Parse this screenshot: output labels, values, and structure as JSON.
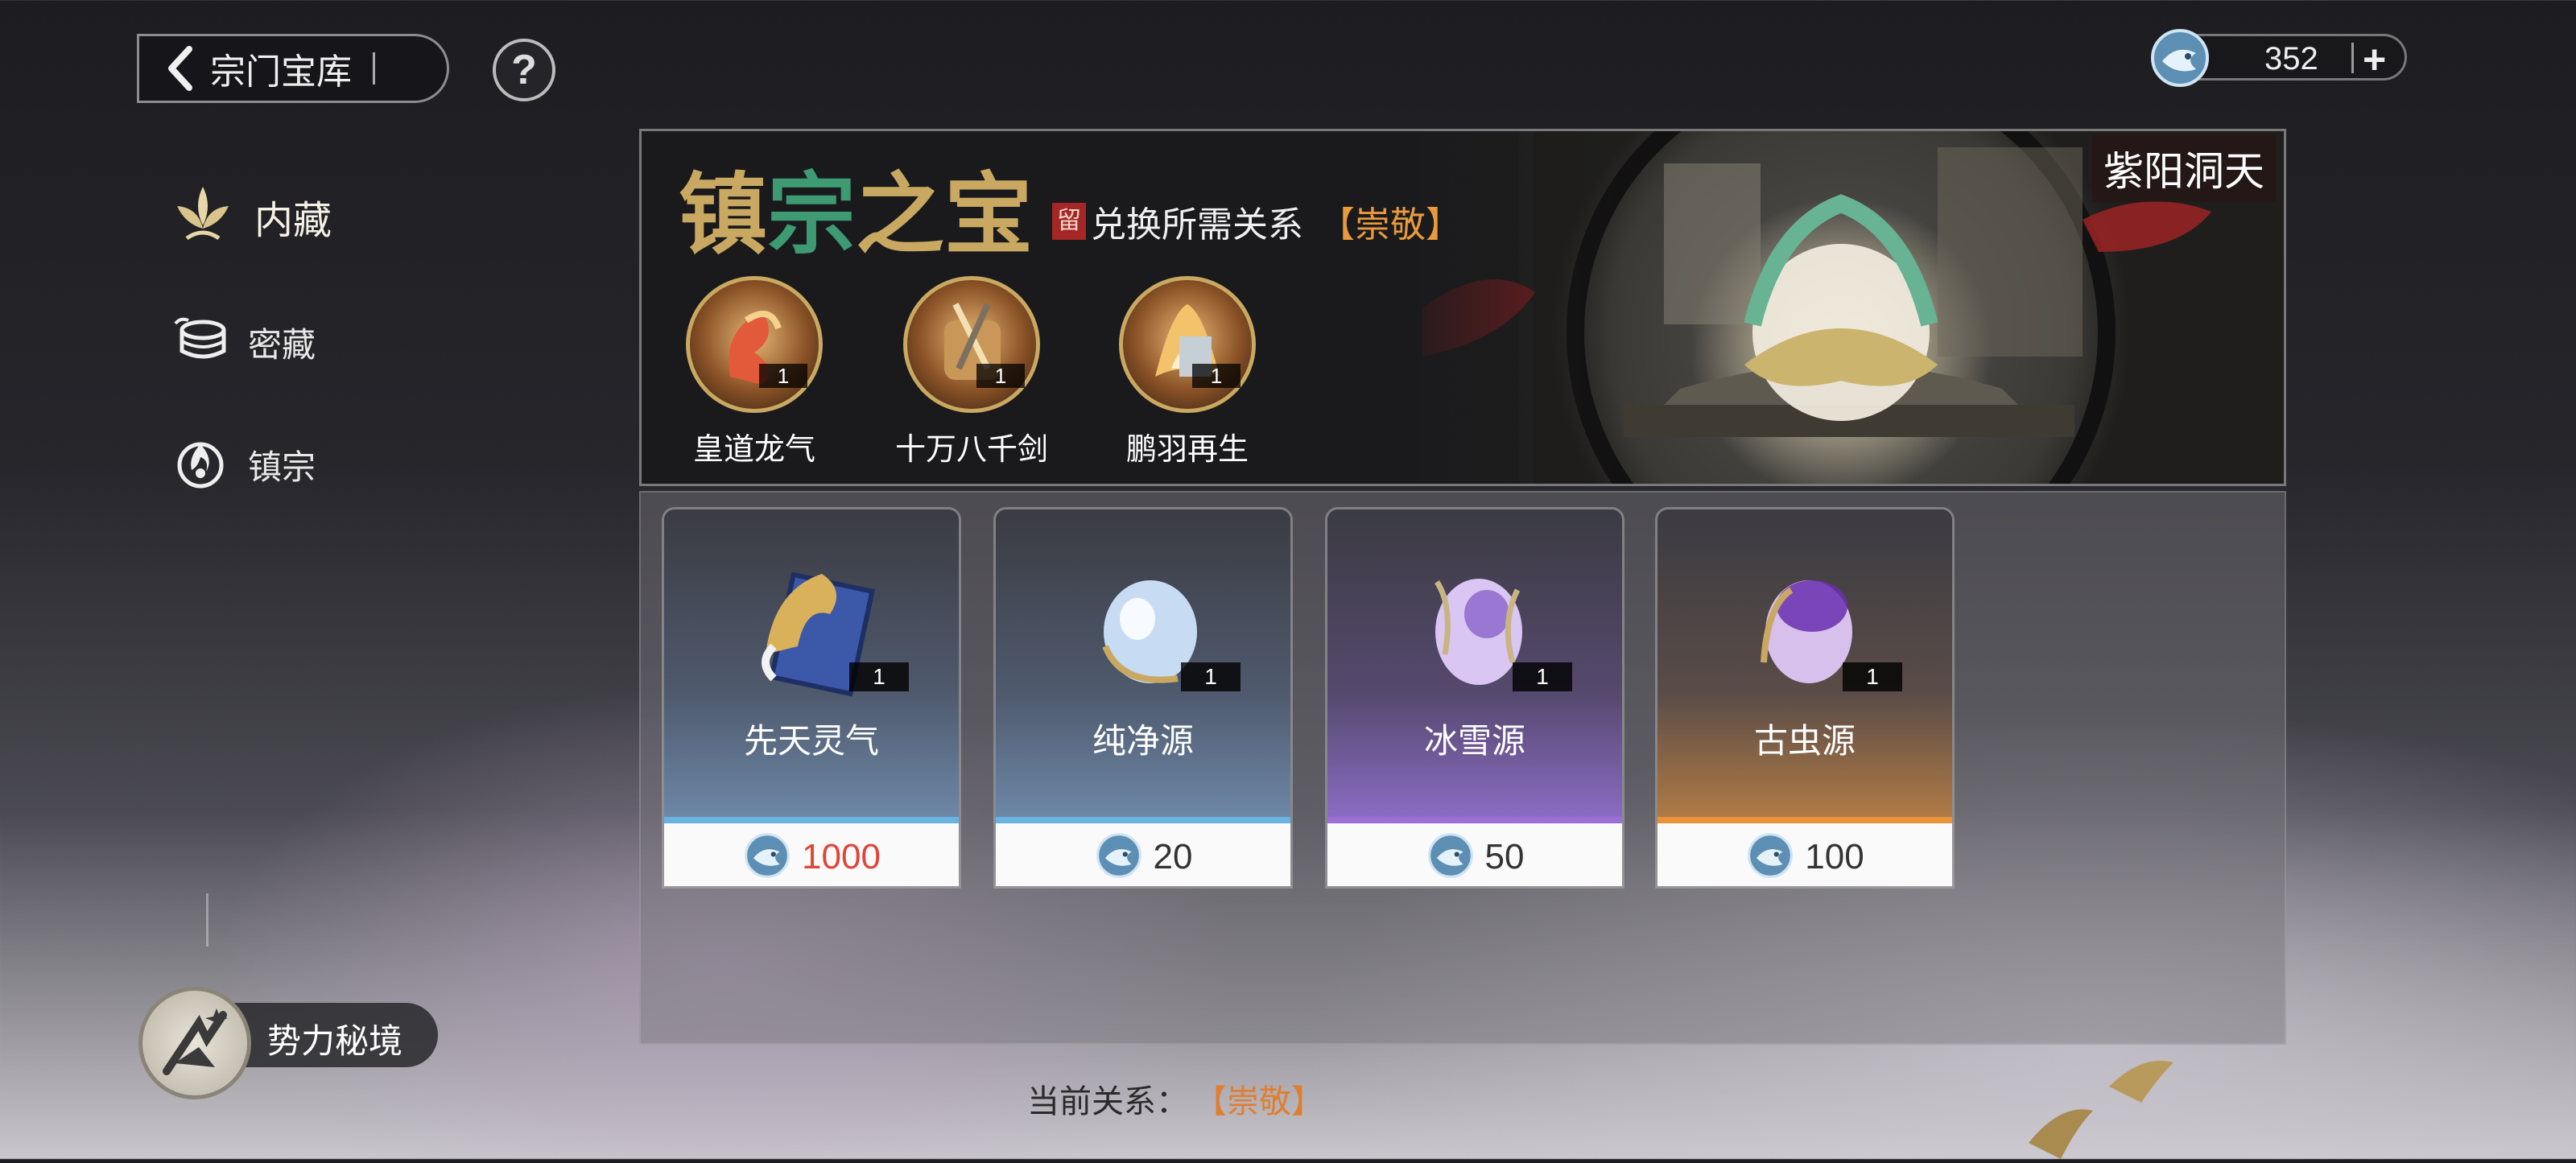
{
  "header": {
    "back_title": "宗门宝库",
    "help_label": "?"
  },
  "currency": {
    "amount": "352",
    "add_label": "+"
  },
  "sidebar": {
    "items": [
      {
        "label": "内藏",
        "active": true
      },
      {
        "label": "密藏",
        "active": false
      },
      {
        "label": "镇宗",
        "active": false
      }
    ]
  },
  "banner": {
    "title_part1": "镇",
    "title_part2": "宗",
    "title_part3": "之宝",
    "stamp": "留",
    "requirement_text": "兑换所需关系",
    "requirement_tag": "【崇敬】",
    "region_name": "紫阳洞天",
    "rewards": [
      {
        "name": "皇道龙气",
        "count": "1"
      },
      {
        "name": "十万八千剑",
        "count": "1"
      },
      {
        "name": "鹏羽再生",
        "count": "1"
      }
    ]
  },
  "shop": {
    "items": [
      {
        "name": "先天灵气",
        "count": "1",
        "price": "1000",
        "price_color": "#e0453a",
        "stripe_color": "#6ab3e0"
      },
      {
        "name": "纯净源",
        "count": "1",
        "price": "20",
        "price_color": "#333333",
        "stripe_color": "#6ab3e0"
      },
      {
        "name": "冰雪源",
        "count": "1",
        "price": "50",
        "price_color": "#333333",
        "stripe_color": "#9b6fd6"
      },
      {
        "name": "古虫源",
        "count": "1",
        "price": "100",
        "price_color": "#333333",
        "stripe_color": "#e8923a"
      }
    ]
  },
  "footer": {
    "relation_label": "当前关系：",
    "relation_value": "【崇敬】",
    "realm_label": "势力秘境"
  }
}
